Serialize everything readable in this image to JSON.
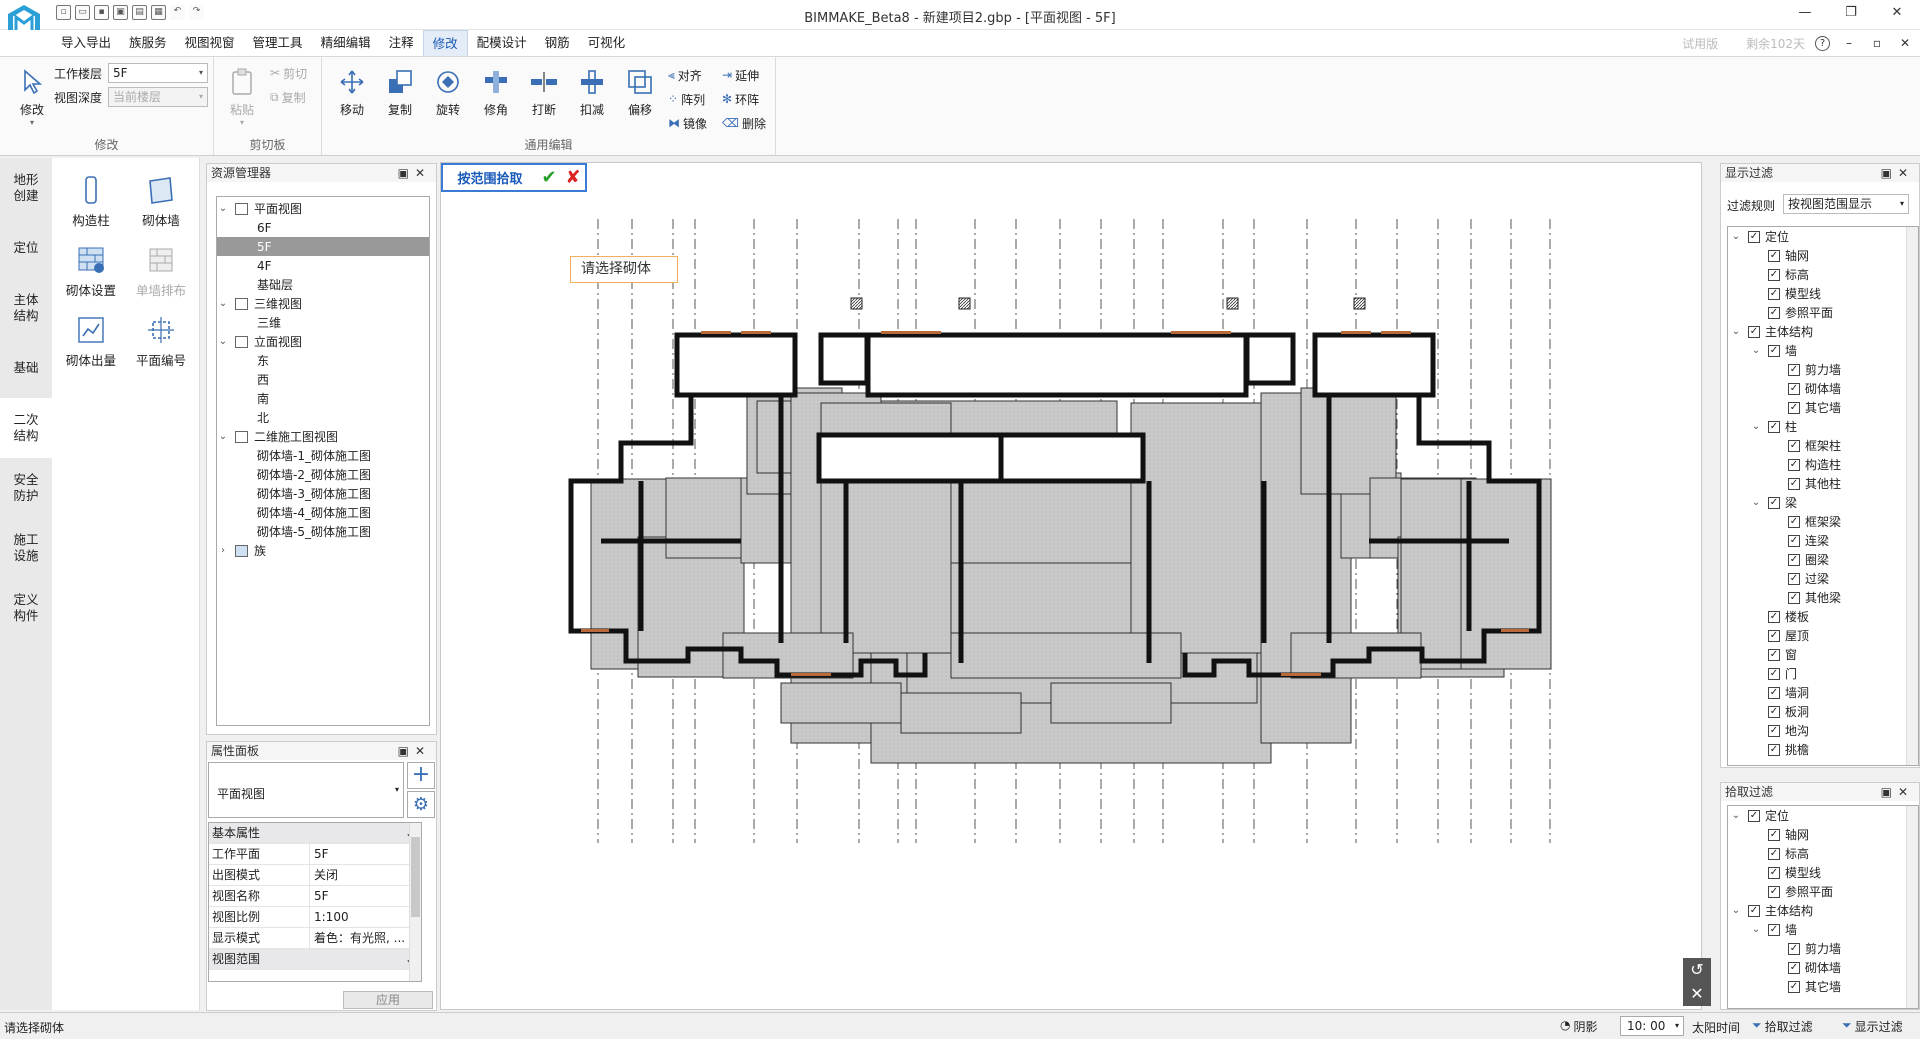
{
  "window": {
    "title": "BIMMAKE_Beta8 - 新建项目2.gbp - [平面视图 - 5F]",
    "controls": [
      "—",
      "❐",
      "✕"
    ]
  },
  "quick_access": [
    "new",
    "open",
    "save",
    "save-as",
    "undo",
    "redo"
  ],
  "menus": [
    "导入导出",
    "族服务",
    "视图视窗",
    "管理工具",
    "精细编辑",
    "注释",
    "修改",
    "配模设计",
    "钢筋",
    "可视化"
  ],
  "active_menu": "修改",
  "menu_right": {
    "trial": "试用版",
    "remaining": "剩余102天",
    "help": "?"
  },
  "ribbon": {
    "modify_group": {
      "label": "修改",
      "modify_btn": "修改",
      "work_floor_label": "工作楼层",
      "work_floor_value": "5F",
      "view_depth_label": "视图深度",
      "view_depth_value": "当前楼层"
    },
    "clipboard_group": {
      "label": "剪切板",
      "paste": "粘贴",
      "cut": "剪切",
      "copy": "复制"
    },
    "edit_group": {
      "label": "通用编辑",
      "buttons": [
        "移动",
        "复制",
        "旋转",
        "修角",
        "打断",
        "扣减",
        "偏移"
      ],
      "small": [
        "对齐",
        "延伸",
        "阵列",
        "环阵",
        "镜像",
        "删除"
      ]
    }
  },
  "categories": [
    "地形创建",
    "定位",
    "主体结构",
    "基础",
    "二次结构",
    "安全防护",
    "施工设施",
    "定义构件"
  ],
  "active_category": "二次结构",
  "tools": [
    {
      "label": "构造柱",
      "enabled": true
    },
    {
      "label": "砌体墙",
      "enabled": true
    },
    {
      "label": "砌体设置",
      "enabled": true
    },
    {
      "label": "单墙排布",
      "enabled": false
    },
    {
      "label": "砌体出量",
      "enabled": true
    },
    {
      "label": "平面编号",
      "enabled": true
    }
  ],
  "resource_manager": {
    "title": "资源管理器",
    "plan_views": "平面视图",
    "floors": [
      "6F",
      "5F",
      "4F",
      "基础层"
    ],
    "selected_floor": "5F",
    "views_3d": "三维视图",
    "view_3d_item": "三维",
    "elevation": "立面视图",
    "elevations": [
      "东",
      "西",
      "南",
      "北"
    ],
    "drawings": "二维施工图视图",
    "drawing_items": [
      "砌体墙-1_砌体施工图",
      "砌体墙-2_砌体施工图",
      "砌体墙-3_砌体施工图",
      "砌体墙-4_砌体施工图",
      "砌体墙-5_砌体施工图"
    ],
    "families": "族"
  },
  "property_panel": {
    "title": "属性面板",
    "type": "平面视图",
    "section_basic": "基本属性",
    "rows": [
      {
        "k": "工作平面",
        "v": "5F"
      },
      {
        "k": "出图模式",
        "v": "关闭"
      },
      {
        "k": "视图名称",
        "v": "5F"
      },
      {
        "k": "视图比例",
        "v": "1:100"
      },
      {
        "k": "显示模式",
        "v": "着色：有光照, ..."
      }
    ],
    "section_range": "视图范围",
    "apply": "应用"
  },
  "canvas": {
    "pick_label": "按范围拾取",
    "prompt": "请选择砌体"
  },
  "display_filter": {
    "title": "显示过滤",
    "rule_label": "过滤规则",
    "rule_value": "按视图范围显示",
    "items": [
      {
        "label": "定位",
        "level": 0,
        "expand": true
      },
      {
        "label": "轴网",
        "level": 1
      },
      {
        "label": "标高",
        "level": 1
      },
      {
        "label": "模型线",
        "level": 1
      },
      {
        "label": "参照平面",
        "level": 1
      },
      {
        "label": "主体结构",
        "level": 0,
        "expand": true
      },
      {
        "label": "墙",
        "level": 1,
        "expand": true
      },
      {
        "label": "剪力墙",
        "level": 2
      },
      {
        "label": "砌体墙",
        "level": 2
      },
      {
        "label": "其它墙",
        "level": 2
      },
      {
        "label": "柱",
        "level": 1,
        "expand": true
      },
      {
        "label": "框架柱",
        "level": 2
      },
      {
        "label": "构造柱",
        "level": 2
      },
      {
        "label": "其他柱",
        "level": 2
      },
      {
        "label": "梁",
        "level": 1,
        "expand": true
      },
      {
        "label": "框架梁",
        "level": 2
      },
      {
        "label": "连梁",
        "level": 2
      },
      {
        "label": "圈梁",
        "level": 2
      },
      {
        "label": "过梁",
        "level": 2
      },
      {
        "label": "其他梁",
        "level": 2
      },
      {
        "label": "楼板",
        "level": 1
      },
      {
        "label": "屋顶",
        "level": 1
      },
      {
        "label": "窗",
        "level": 1
      },
      {
        "label": "门",
        "level": 1
      },
      {
        "label": "墙洞",
        "level": 1
      },
      {
        "label": "板洞",
        "level": 1
      },
      {
        "label": "地沟",
        "level": 1
      },
      {
        "label": "挑檐",
        "level": 1
      }
    ]
  },
  "pick_filter": {
    "title": "拾取过滤",
    "items": [
      {
        "label": "定位",
        "level": 0,
        "expand": true
      },
      {
        "label": "轴网",
        "level": 1
      },
      {
        "label": "标高",
        "level": 1
      },
      {
        "label": "模型线",
        "level": 1
      },
      {
        "label": "参照平面",
        "level": 1
      },
      {
        "label": "主体结构",
        "level": 0,
        "expand": true
      },
      {
        "label": "墙",
        "level": 1,
        "expand": true
      },
      {
        "label": "剪力墙",
        "level": 2
      },
      {
        "label": "砌体墙",
        "level": 2
      },
      {
        "label": "其它墙",
        "level": 2
      }
    ]
  },
  "statusbar": {
    "message": "请选择砌体",
    "shadow": "阴影",
    "time": "10: 00",
    "sun_time": "太阳时间",
    "pick_filter": "拾取过滤",
    "display_filter": "显示过滤"
  }
}
